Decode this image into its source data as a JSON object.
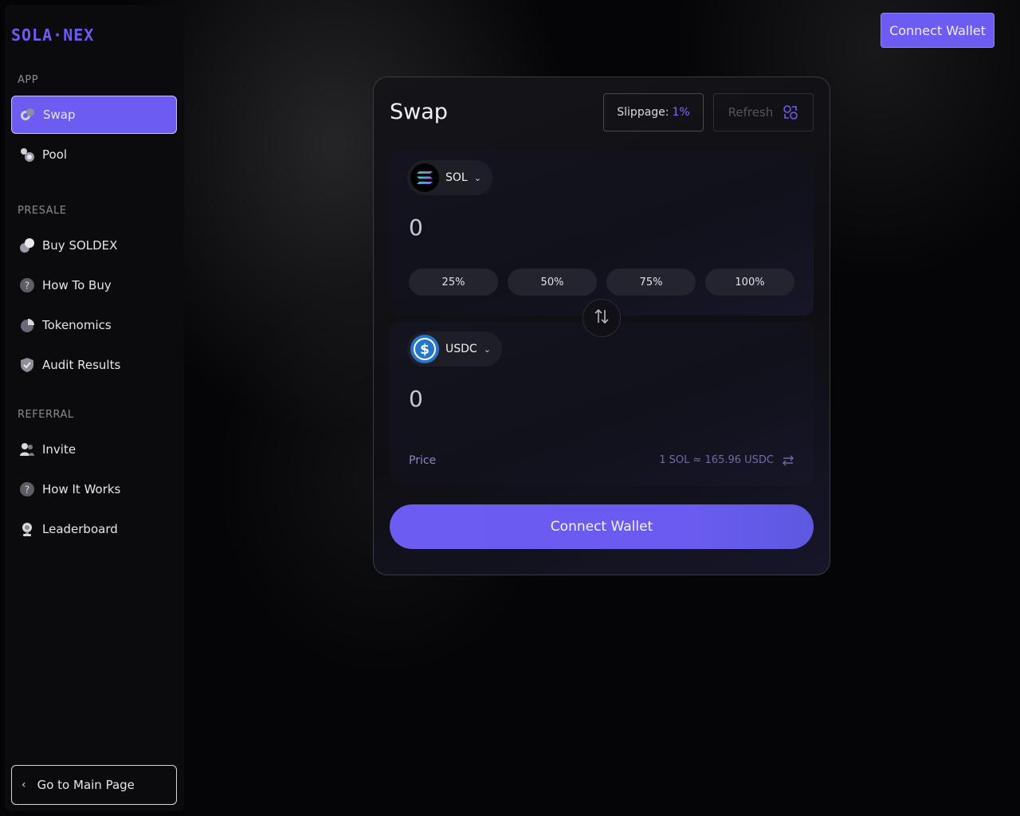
{
  "brand": {
    "logo_text": "SOLA·NEX"
  },
  "sidebar": {
    "sections": [
      {
        "label": "APP"
      },
      {
        "label": "PRESALE"
      },
      {
        "label": "REFERRAL"
      }
    ],
    "items": [
      {
        "label": "Swap",
        "icon": "swap-icon",
        "active": true
      },
      {
        "label": "Pool",
        "icon": "pool-icon"
      },
      {
        "label": "Buy SOLDEX",
        "icon": "buy-icon"
      },
      {
        "label": "How To Buy",
        "icon": "question-icon"
      },
      {
        "label": "Tokenomics",
        "icon": "pie-chart-icon"
      },
      {
        "label": "Audit Results",
        "icon": "shield-check-icon"
      },
      {
        "label": "Invite",
        "icon": "users-icon"
      },
      {
        "label": "How It Works",
        "icon": "question-icon"
      },
      {
        "label": "Leaderboard",
        "icon": "trophy-icon"
      }
    ],
    "main_page_label": "Go to Main Page"
  },
  "header": {
    "connect_label": "Connect Wallet"
  },
  "swap": {
    "title": "Swap",
    "slippage_label": "Slippage:",
    "slippage_value": "1%",
    "refresh_label": "Refresh",
    "from": {
      "token": "SOL",
      "amount": "0"
    },
    "percent_buttons": [
      "25%",
      "50%",
      "75%",
      "100%"
    ],
    "to": {
      "token": "USDC",
      "amount": "0"
    },
    "price_label": "Price",
    "price_value": "1 SOL ≈ 165.96 USDC",
    "connect_label": "Connect Wallet"
  },
  "colors": {
    "accent": "#6c5cf2",
    "background": "#050507",
    "usdc": "#2775ca"
  }
}
